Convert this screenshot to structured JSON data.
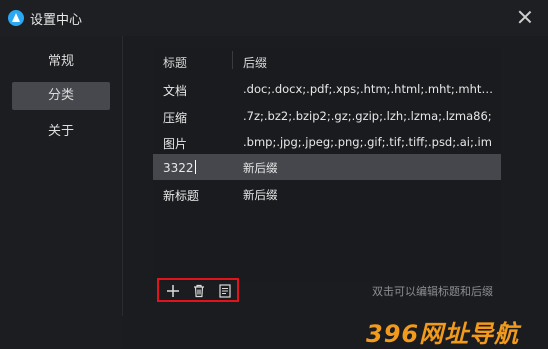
{
  "window": {
    "title": "设置中心"
  },
  "sidebar": {
    "items": [
      {
        "label": "常规"
      },
      {
        "label": "分类"
      },
      {
        "label": "关于"
      }
    ]
  },
  "table": {
    "columns": [
      "标题",
      "后缀"
    ],
    "rows": [
      {
        "title": "文档",
        "suffix": ".doc;.docx;.pdf;.xps;.htm;.html;.mht;.mhtml"
      },
      {
        "title": "压缩",
        "suffix": ".7z;.bz2;.bzip2;.gz;.gzip;.lzh;.lzma;.lzma86;"
      },
      {
        "title": "图片",
        "suffix": ".bmp;.jpg;.jpeg;.png;.gif;.tif;.tiff;.psd;.ai;.im"
      },
      {
        "title": "3322",
        "suffix": "新后缀"
      },
      {
        "title": "新标题",
        "suffix": "新后缀"
      }
    ]
  },
  "toolbar": {
    "hint": "双击可以编辑标题和后缀",
    "icons": [
      "add-icon",
      "trash-icon",
      "document-icon"
    ]
  },
  "watermark": "396网址导航",
  "colors": {
    "accent": "#2aa8f2",
    "highlight_border": "#e3131b",
    "selected_row": "#45474c",
    "watermark": "#f19a1c"
  }
}
